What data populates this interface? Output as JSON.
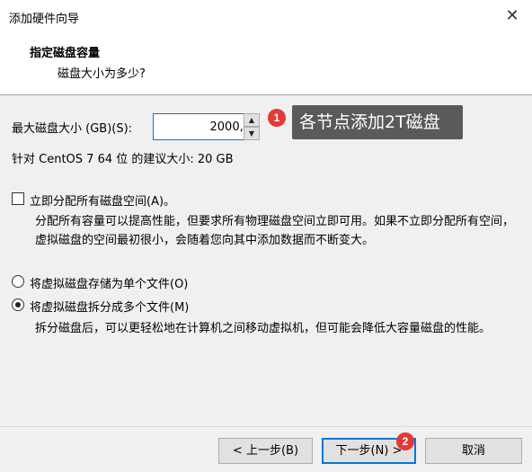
{
  "window": {
    "title": "添加硬件向导",
    "close_glyph": "✕"
  },
  "header": {
    "title": "指定磁盘容量",
    "subtitle": "磁盘大小为多少?"
  },
  "disk_size": {
    "label": "最大磁盘大小 (GB)(S):",
    "value": "2000,0",
    "spin_up": "▲",
    "spin_down": "▼",
    "recommended": "针对 CentOS 7 64 位 的建议大小: 20 GB"
  },
  "allocate_now": {
    "label": "立即分配所有磁盘空间(A)。",
    "checked": false,
    "description": "分配所有容量可以提高性能，但要求所有物理磁盘空间立即可用。如果不立即分配所有空间，虚拟磁盘的空间最初很小，会随着您向其中添加数据而不断变大。"
  },
  "storage_options": [
    {
      "label": "将虚拟磁盘存储为单个文件(O)",
      "checked": false
    },
    {
      "label": "将虚拟磁盘拆分成多个文件(M)",
      "checked": true
    }
  ],
  "split_description": "拆分磁盘后，可以更轻松地在计算机之间移动虚拟机，但可能会降低大容量磁盘的性能。",
  "annotations": {
    "badge1": "1",
    "callout1": "各节点添加2T磁盘",
    "badge2": "2"
  },
  "buttons": {
    "back": "< 上一步(B)",
    "next": "下一步(N) >",
    "cancel": "取消"
  },
  "colors": {
    "accent": "#0078d7",
    "badge": "#e53935",
    "callout_bg": "#5a5a5a"
  }
}
